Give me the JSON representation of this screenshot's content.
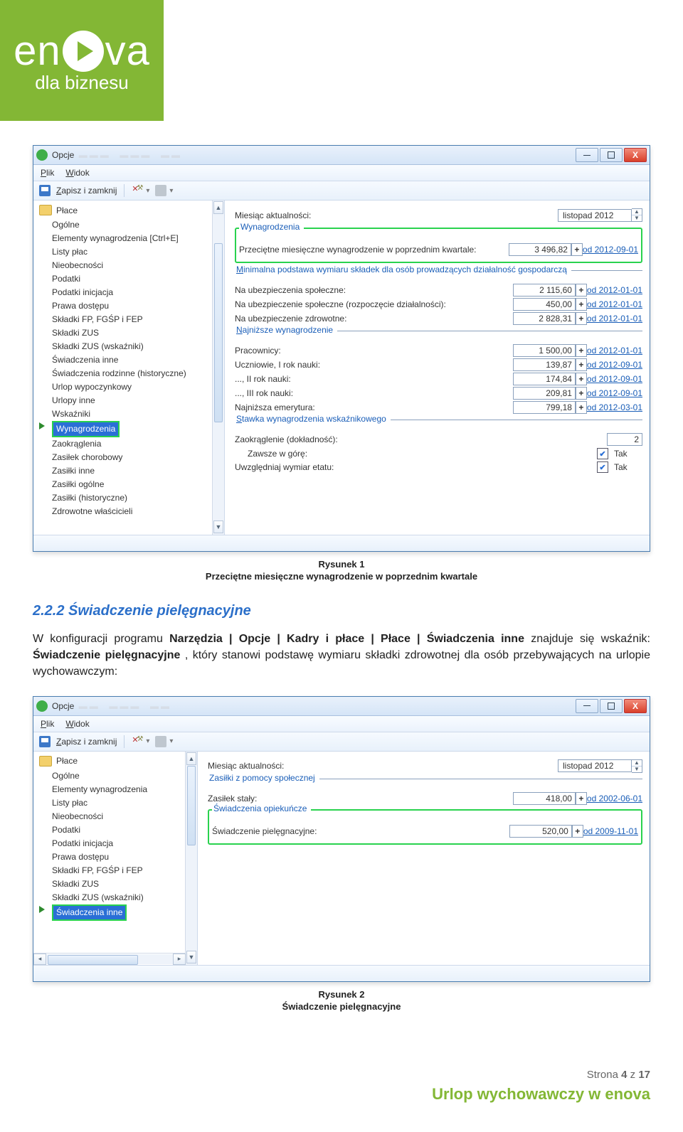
{
  "brand": {
    "main_pre": "en",
    "main_post": "va",
    "sub": "dla biznesu"
  },
  "win1": {
    "title": "Opcje",
    "menu": {
      "plik": "Plik",
      "widok": "Widok"
    },
    "toolbar": {
      "saveclose": "Zapisz i zamknij"
    },
    "nav": {
      "root": "Płace",
      "items": [
        "Ogólne",
        "Elementy wynagrodzenia [Ctrl+E]",
        "Listy płac",
        "Nieobecności",
        "Podatki",
        "Podatki inicjacja",
        "Prawa dostępu",
        "Składki FP, FGŚP i FEP",
        "Składki ZUS",
        "Składki ZUS (wskaźniki)",
        "Świadczenia inne",
        "Świadczenia rodzinne (historyczne)",
        "Urlop wypoczynkowy",
        "Urlopy inne",
        "Wskaźniki",
        "Wynagrodzenia",
        "Zaokrąglenia",
        "Zasiłek chorobowy",
        "Zasiłki inne",
        "Zasiłki ogólne",
        "Zasiłki (historyczne)",
        "Zdrowotne właścicieli"
      ],
      "selected": "Wynagrodzenia"
    },
    "form": {
      "monthLabel": "Miesiąc aktualności:",
      "monthValue": "listopad 2012",
      "fs_wynagrodzenia": "Wynagrodzenia",
      "avgLabel": "Przeciętne miesięczne wynagrodzenie w poprzednim kwartale:",
      "avgVal": "3 496,82",
      "avgDate": "od 2012-09-01",
      "fs_min": "Minimalna podstawa wymiaru składek dla osób prowadzących działalność gospodarczą",
      "rows_min": [
        {
          "l": "Na ubezpieczenia społeczne:",
          "v": "2 115,60",
          "d": "od 2012-01-01"
        },
        {
          "l": "Na ubezpieczenie społeczne (rozpoczęcie działalności):",
          "v": "450,00",
          "d": "od 2012-01-01"
        },
        {
          "l": "Na ubezpieczenie zdrowotne:",
          "v": "2 828,31",
          "d": "od 2012-01-01"
        }
      ],
      "fs_najn": "Najniższe wynagrodzenie",
      "rows_najn": [
        {
          "l": "Pracownicy:",
          "v": "1 500,00",
          "d": "od 2012-01-01"
        },
        {
          "l": "Uczniowie, I rok nauki:",
          "v": "139,87",
          "d": "od 2012-09-01"
        },
        {
          "l": "..., II rok nauki:",
          "v": "174,84",
          "d": "od 2012-09-01"
        },
        {
          "l": "..., III rok nauki:",
          "v": "209,81",
          "d": "od 2012-09-01"
        },
        {
          "l": "Najniższa emerytura:",
          "v": "799,18",
          "d": "od 2012-03-01"
        }
      ],
      "fs_stawka": "Stawka wynagrodzenia wskaźnikowego",
      "zaokLabel": "Zaokrąglenie (dokładność):",
      "zaokVal": "2",
      "zawszeLabel": "Zawsze w górę:",
      "tak": "Tak",
      "wymiarLabel": "Uwzględniaj wymiar etatu:"
    }
  },
  "caption1_a": "Rysunek 1",
  "caption1_b": "Przeciętne miesięczne wynagrodzenie w poprzednim kwartale",
  "section": {
    "heading": "2.2.2  Świadczenie pielęgnacyjne",
    "para_pre": "W konfiguracji programu ",
    "bold1": "Narzędzia | Opcje | Kadry i płace | Płace | Świadczenia inne",
    "para_mid": " znajduje się wskaźnik: ",
    "bold2": "Świadczenie pielęgnacyjne",
    "para_post": ", który stanowi podstawę wymiaru składki zdrowotnej dla osób przebywających na urlopie wychowawczym:"
  },
  "win2": {
    "title": "Opcje",
    "menu": {
      "plik": "Plik",
      "widok": "Widok"
    },
    "toolbar": {
      "saveclose": "Zapisz i zamknij"
    },
    "nav": {
      "root": "Płace",
      "items": [
        "Ogólne",
        "Elementy wynagrodzenia",
        "Listy płac",
        "Nieobecności",
        "Podatki",
        "Podatki inicjacja",
        "Prawa dostępu",
        "Składki FP, FGŚP i FEP",
        "Składki ZUS",
        "Składki ZUS (wskaźniki)",
        "Świadczenia inne"
      ],
      "selected": "Świadczenia inne"
    },
    "form": {
      "monthLabel": "Miesiąc aktualności:",
      "monthValue": "listopad 2012",
      "fs_zasilki": "Zasiłki z pomocy społecznej",
      "zasilekLabel": "Zasiłek stały:",
      "zasilekVal": "418,00",
      "zasilekDate": "od 2002-06-01",
      "fs_opiek": "Świadczenia opiekuńcze",
      "swiadLabel": "Świadczenie pielęgnacyjne:",
      "swiadVal": "520,00",
      "swiadDate": "od 2009-11-01"
    }
  },
  "caption2_a": "Rysunek 2",
  "caption2_b": "Świadczenie pielęgnacyjne",
  "footer": {
    "page": "Strona 4 z 17",
    "tagline": "Urlop wychowawczy w enova"
  }
}
